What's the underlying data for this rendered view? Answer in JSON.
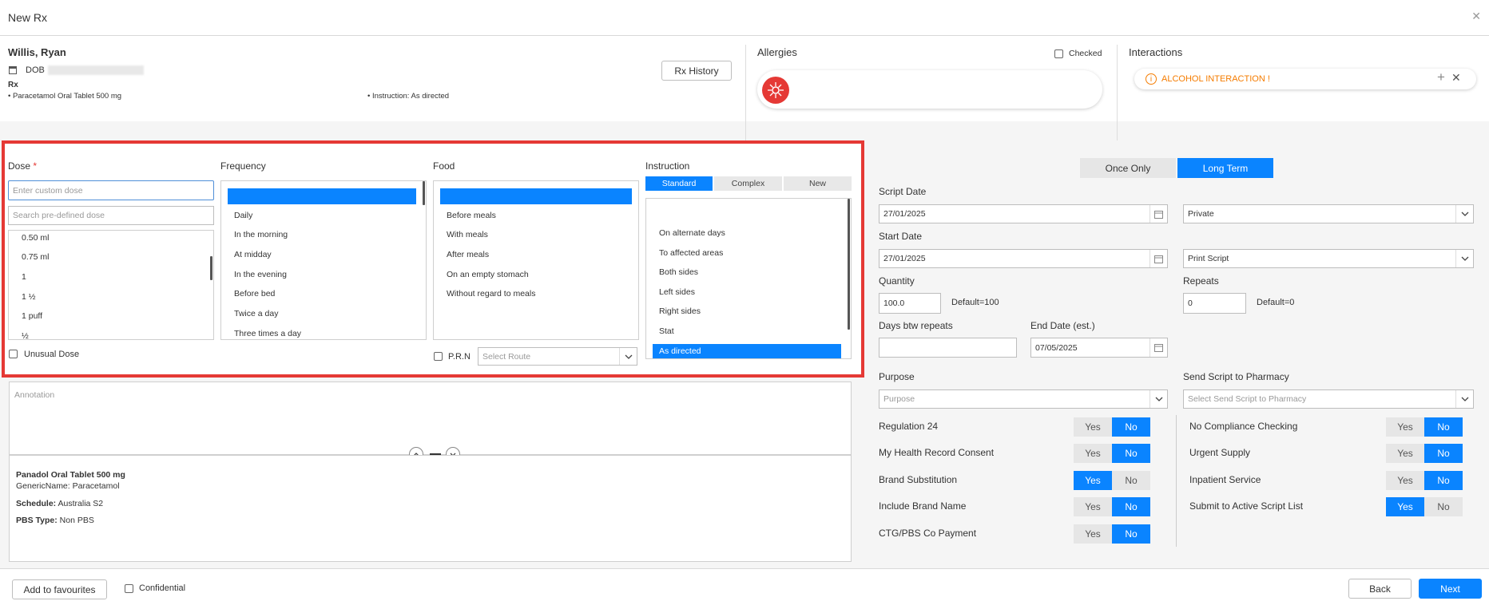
{
  "window": {
    "title": "New Rx"
  },
  "patient": {
    "name": "Willis, Ryan",
    "dob_label": "DOB",
    "rx_label": "Rx",
    "rx_item": "Paracetamol Oral Tablet 500 mg",
    "rx_instruction": "Instruction: As directed",
    "history_button": "Rx History"
  },
  "allergies": {
    "title": "Allergies",
    "checked_label": "Checked"
  },
  "interactions": {
    "title": "Interactions",
    "alert": "ALCOHOL INTERACTION !"
  },
  "dose": {
    "title": "Dose",
    "required_mark": "*",
    "custom_placeholder": "Enter custom dose",
    "search_placeholder": "Search pre-defined dose",
    "options": [
      "0.50 ml",
      "0.75 ml",
      "1",
      "1 ½",
      "1 puff",
      "½"
    ],
    "unusual_label": "Unusual Dose"
  },
  "frequency": {
    "title": "Frequency",
    "options": [
      "Daily",
      "In the morning",
      "At midday",
      "In the evening",
      "Before bed",
      "Twice a day",
      "Three times a day"
    ]
  },
  "food": {
    "title": "Food",
    "options": [
      "Before meals",
      "With meals",
      "After meals",
      "On an empty stomach",
      "Without regard to meals"
    ],
    "prn_label": "P.R.N",
    "route_placeholder": "Select Route"
  },
  "instruction": {
    "title": "Instruction",
    "tabs": [
      "Standard",
      "Complex",
      "New"
    ],
    "options": [
      "On alternate days",
      "To affected areas",
      "Both sides",
      "Left sides",
      "Right sides",
      "Stat",
      "As directed"
    ]
  },
  "annotation": {
    "placeholder": "Annotation"
  },
  "drug_info": {
    "name": "Panadol Oral Tablet 500 mg",
    "generic_label": "GenericName:",
    "generic_value": "Paracetamol",
    "schedule_label": "Schedule:",
    "schedule_value": "Australia S2",
    "pbs_label": "PBS Type:",
    "pbs_value": "Non PBS"
  },
  "term": {
    "once": "Once Only",
    "long": "Long Term"
  },
  "form": {
    "script_date_label": "Script Date",
    "script_date": "27/01/2025",
    "private_value": "Private",
    "start_date_label": "Start Date",
    "start_date": "27/01/2025",
    "print_value": "Print Script",
    "quantity_label": "Quantity",
    "quantity": "100.0",
    "quantity_default": "Default=100",
    "repeats_label": "Repeats",
    "repeats": "0",
    "repeats_default": "Default=0",
    "days_label": "Days btw repeats",
    "end_date_label": "End Date (est.)",
    "end_date": "07/05/2025",
    "purpose_label": "Purpose",
    "purpose_placeholder": "Purpose",
    "send_label": "Send Script to Pharmacy",
    "send_placeholder": "Select Send Script to Pharmacy"
  },
  "toggles_left": [
    {
      "label": "Regulation 24",
      "yes": "Yes",
      "no": "No",
      "value": "No"
    },
    {
      "label": "My Health Record Consent",
      "yes": "Yes",
      "no": "No",
      "value": "No"
    },
    {
      "label": "Brand Substitution",
      "yes": "Yes",
      "no": "No",
      "value": "Yes"
    },
    {
      "label": "Include Brand Name",
      "yes": "Yes",
      "no": "No",
      "value": "No"
    },
    {
      "label": "CTG/PBS Co Payment",
      "yes": "Yes",
      "no": "No",
      "value": "No"
    }
  ],
  "toggles_right": [
    {
      "label": "No Compliance Checking",
      "yes": "Yes",
      "no": "No",
      "value": "No"
    },
    {
      "label": "Urgent Supply",
      "yes": "Yes",
      "no": "No",
      "value": "No"
    },
    {
      "label": "Inpatient Service",
      "yes": "Yes",
      "no": "No",
      "value": "No"
    },
    {
      "label": "Submit to Active Script List",
      "yes": "Yes",
      "no": "No",
      "value": "Yes"
    }
  ],
  "footer": {
    "favourites": "Add to favourites",
    "confidential": "Confidential",
    "back": "Back",
    "next": "Next"
  },
  "colors": {
    "accent": "#0a84ff",
    "highlight": "#e53935",
    "alert": "#f57c00"
  }
}
